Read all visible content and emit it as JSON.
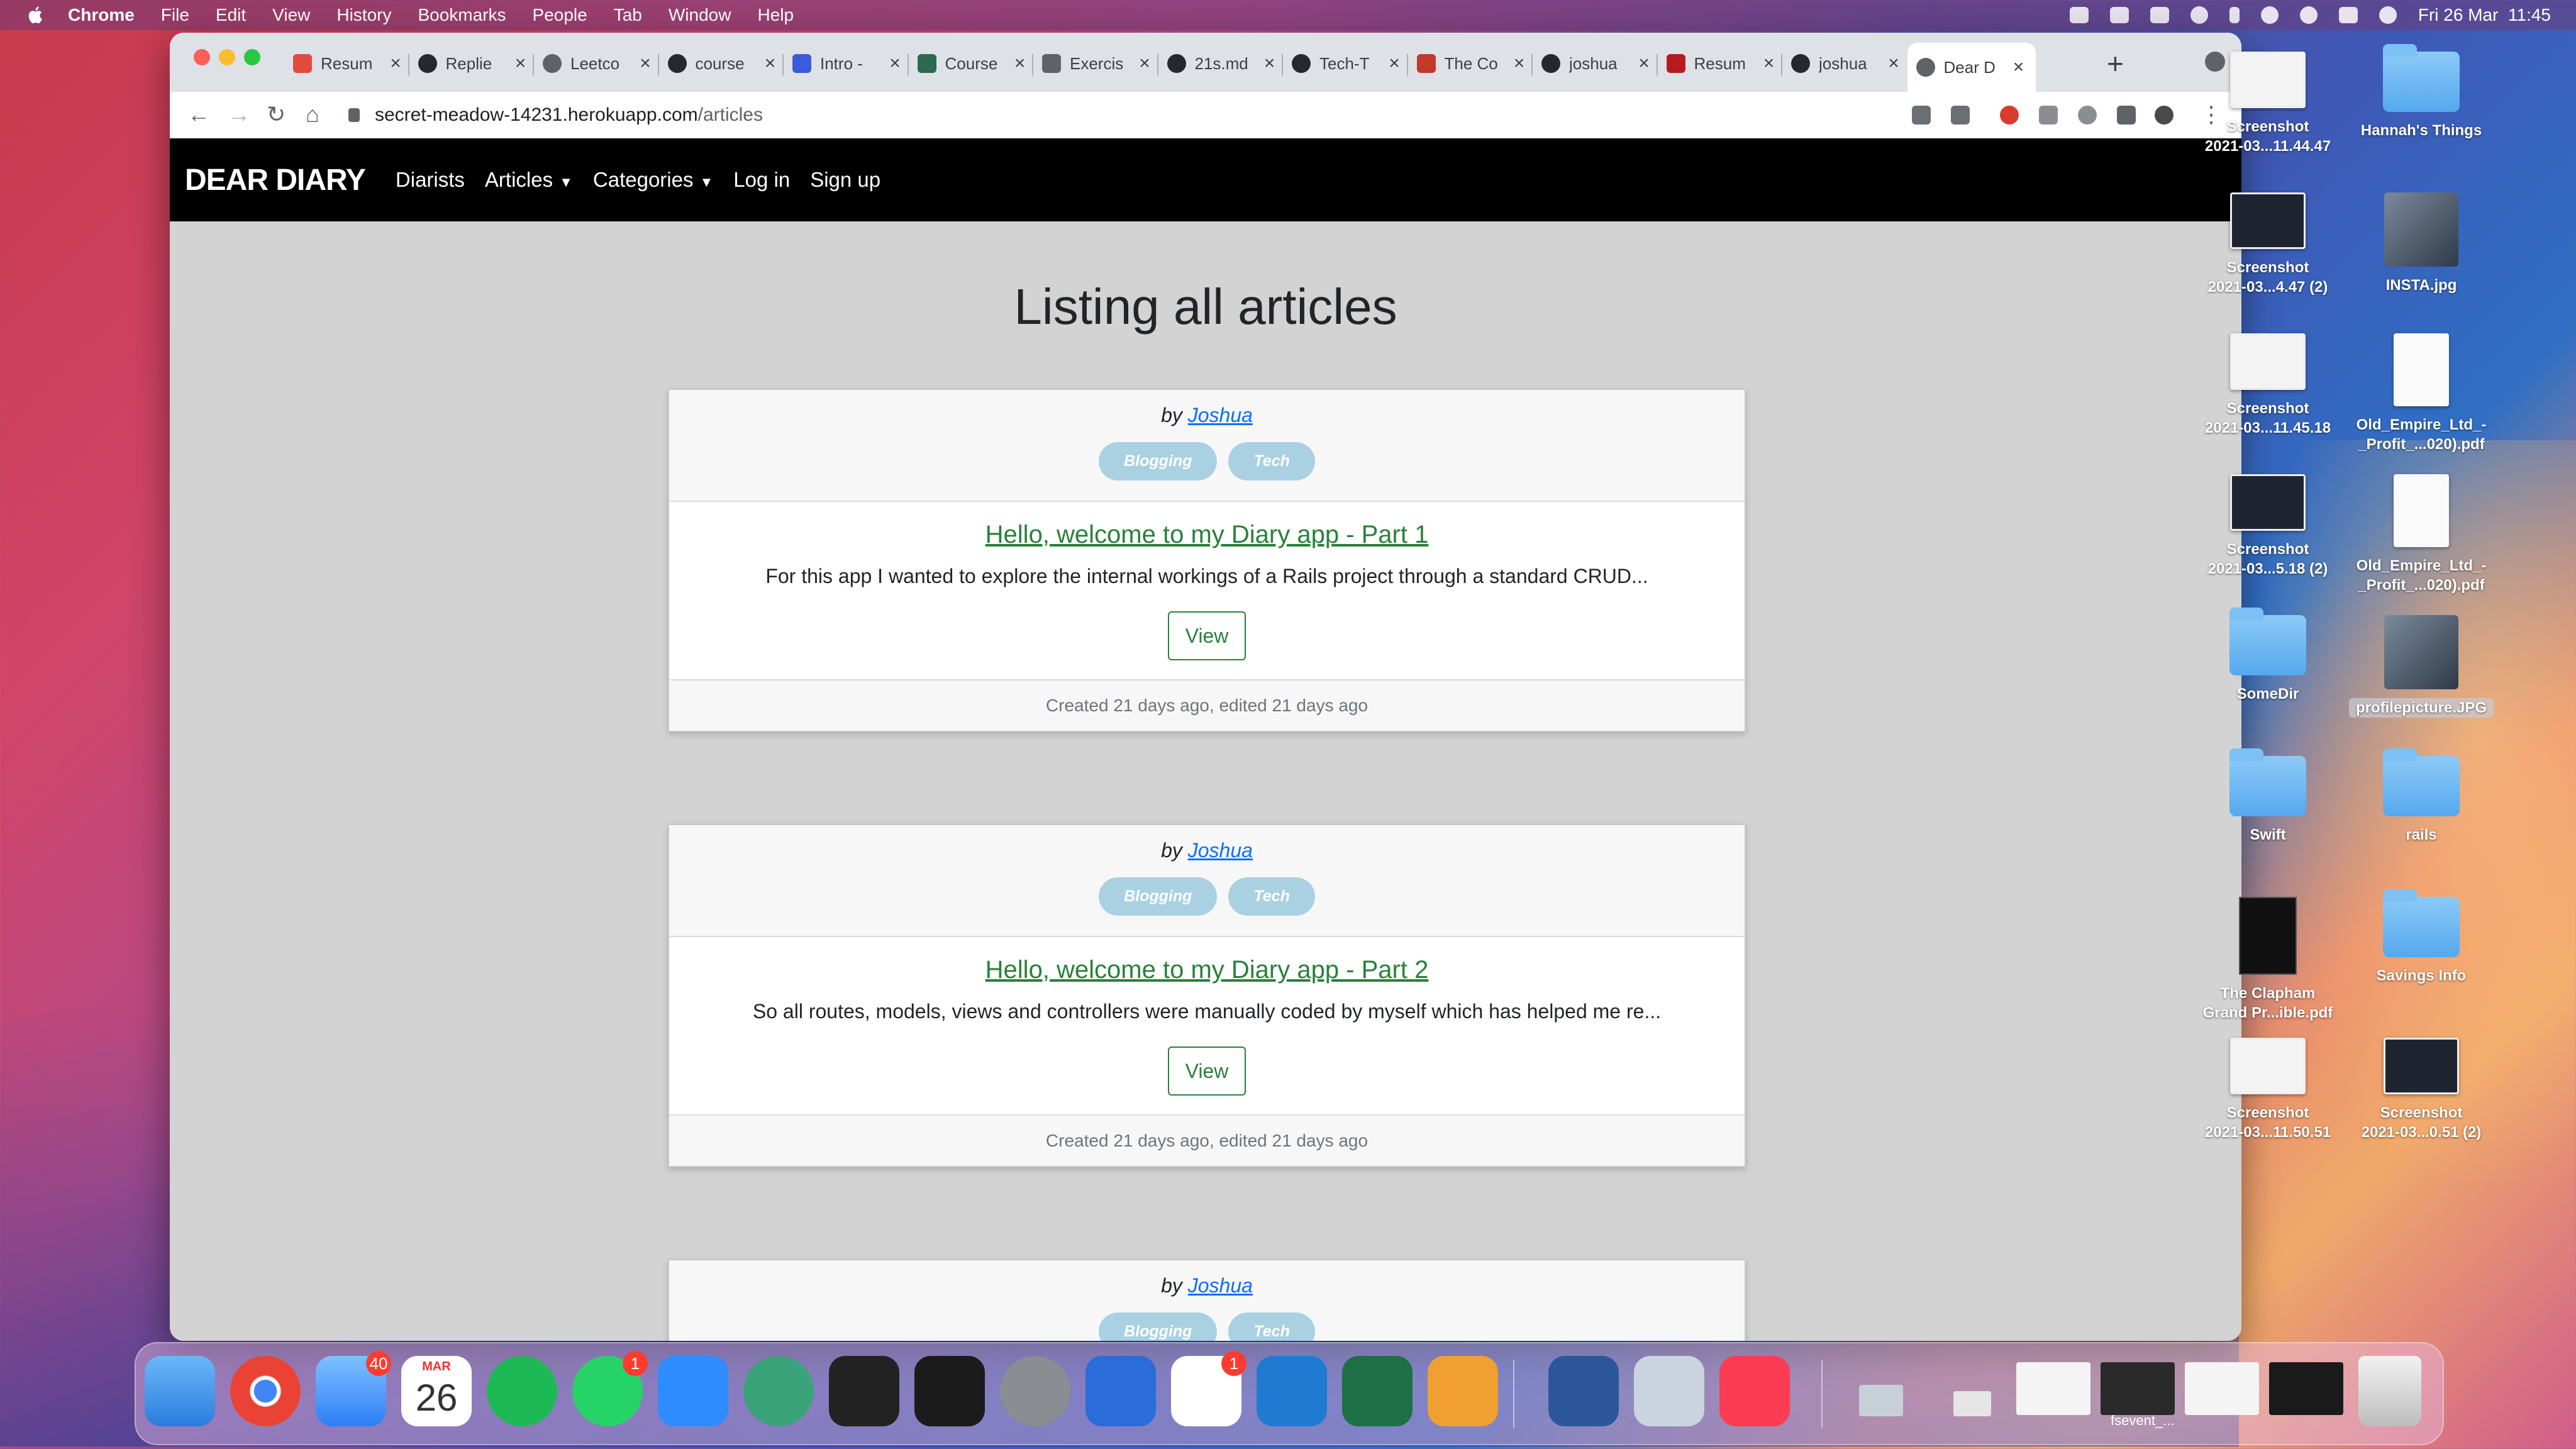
{
  "menubar": {
    "app_name": "Chrome",
    "menus": [
      "File",
      "Edit",
      "View",
      "History",
      "Bookmarks",
      "People",
      "Tab",
      "Window",
      "Help"
    ],
    "clock": "Fri 26 Mar  11:45"
  },
  "browser": {
    "tabs": [
      {
        "label": "Resum",
        "icon": "resume-s-icon",
        "color": "#e04a3f"
      },
      {
        "label": "Replie",
        "icon": "github-icon",
        "color": "#24292e"
      },
      {
        "label": "Leetco",
        "icon": "globe-icon",
        "color": "#5f6368"
      },
      {
        "label": "course",
        "icon": "github-icon",
        "color": "#24292e"
      },
      {
        "label": "Intro -",
        "icon": "vim-icon",
        "color": "#3b5bdb"
      },
      {
        "label": "Course",
        "icon": "course-icon",
        "color": "#2b6a4f"
      },
      {
        "label": "Exercis",
        "icon": "braces-icon",
        "color": "#5f6368"
      },
      {
        "label": "21s.md",
        "icon": "github-icon",
        "color": "#24292e"
      },
      {
        "label": "Tech-T",
        "icon": "github-icon",
        "color": "#24292e"
      },
      {
        "label": "The Co",
        "icon": "coursera-icon",
        "color": "#c0392b"
      },
      {
        "label": "joshua",
        "icon": "github-icon",
        "color": "#24292e"
      },
      {
        "label": "Resum",
        "icon": "resume-red-icon",
        "color": "#b71c1c"
      },
      {
        "label": "joshua",
        "icon": "github-icon",
        "color": "#24292e"
      },
      {
        "label": "Dear D",
        "icon": "globe-icon",
        "color": "#5f6368",
        "active": true
      }
    ],
    "url_host": "secret-meadow-14231.herokuapp.com",
    "url_path": "/articles"
  },
  "site": {
    "brand": "DEAR DIARY",
    "nav": {
      "diarists": "Diarists",
      "articles": "Articles",
      "categories": "Categories",
      "login": "Log in",
      "signup": "Sign up"
    },
    "page_title": "Listing all articles",
    "articles": [
      {
        "by": "by",
        "author": "Joshua",
        "categories": [
          "Blogging",
          "Tech"
        ],
        "title": "Hello, welcome to my Diary app - Part 1",
        "excerpt": "For this app I wanted to explore the internal workings of a Rails project through a standard CRUD...",
        "view_label": "View",
        "meta": "Created 21 days ago, edited 21 days ago"
      },
      {
        "by": "by",
        "author": "Joshua",
        "categories": [
          "Blogging",
          "Tech"
        ],
        "title": "Hello, welcome to my Diary app - Part 2",
        "excerpt": "So all routes, models, views and controllers were manually coded by myself which has helped me re...",
        "view_label": "View",
        "meta": "Created 21 days ago, edited 21 days ago"
      },
      {
        "by": "by",
        "author": "Joshua",
        "categories": [
          "Blogging",
          "Tech"
        ]
      }
    ]
  },
  "desktop": {
    "items": [
      {
        "label": "Screenshot\n2021-03...11.44.47",
        "kind": "screenshot-light"
      },
      {
        "label": "Hannah's Things",
        "kind": "folder"
      },
      {
        "label": "Screenshot\n2021-03...4.47 (2)",
        "kind": "screenshot-dark"
      },
      {
        "label": "INSTA.jpg",
        "kind": "image"
      },
      {
        "label": "Screenshot\n2021-03...11.45.18",
        "kind": "screenshot-light"
      },
      {
        "label": "Old_Empire_Ltd_-\n_Profit_...020).pdf",
        "kind": "pdf"
      },
      {
        "label": "Screenshot\n2021-03...5.18 (2)",
        "kind": "screenshot-dark"
      },
      {
        "label": "Old_Empire_Ltd_-\n_Profit_...020).pdf",
        "kind": "pdf"
      },
      {
        "label": "SomeDir",
        "kind": "folder"
      },
      {
        "label": "profilepicture.JPG",
        "kind": "photo"
      },
      {
        "label": "Swift",
        "kind": "folder"
      },
      {
        "label": "rails",
        "kind": "folder"
      },
      {
        "label": "The Clapham\nGrand Pr...ible.pdf",
        "kind": "book"
      },
      {
        "label": "Savings Info",
        "kind": "folder"
      },
      {
        "label": "Screenshot\n2021-03...11.50.51",
        "kind": "screenshot-light"
      },
      {
        "label": "Screenshot\n2021-03...0.51 (2)",
        "kind": "screenshot-dark"
      }
    ]
  },
  "dock": {
    "mail_badge": "40",
    "calendar_month": "MAR",
    "calendar_day": "26",
    "whatsapp_badge": "1",
    "slack_badge": "1",
    "fsevent_label": "fsevent_..."
  }
}
